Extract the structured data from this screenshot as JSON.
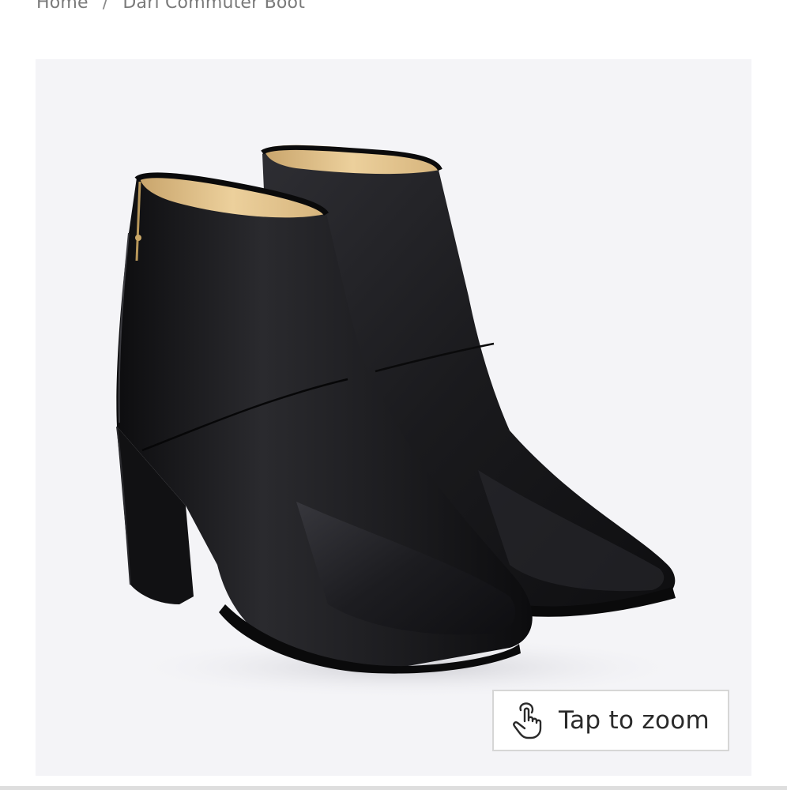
{
  "breadcrumb": {
    "home_label": "Home",
    "separator": "/",
    "current_label": "Dari Commuter Boot"
  },
  "gallery": {
    "image_subject": "pair of black leather ankle boots with block heel and back zipper",
    "zoom_button_label": "Tap to zoom",
    "zoom_icon": "hand-tap-icon"
  },
  "colors": {
    "gallery_background": "#f4f4f7",
    "boot_leather": "#1a1a1c",
    "boot_lining": "#e3c48f"
  }
}
